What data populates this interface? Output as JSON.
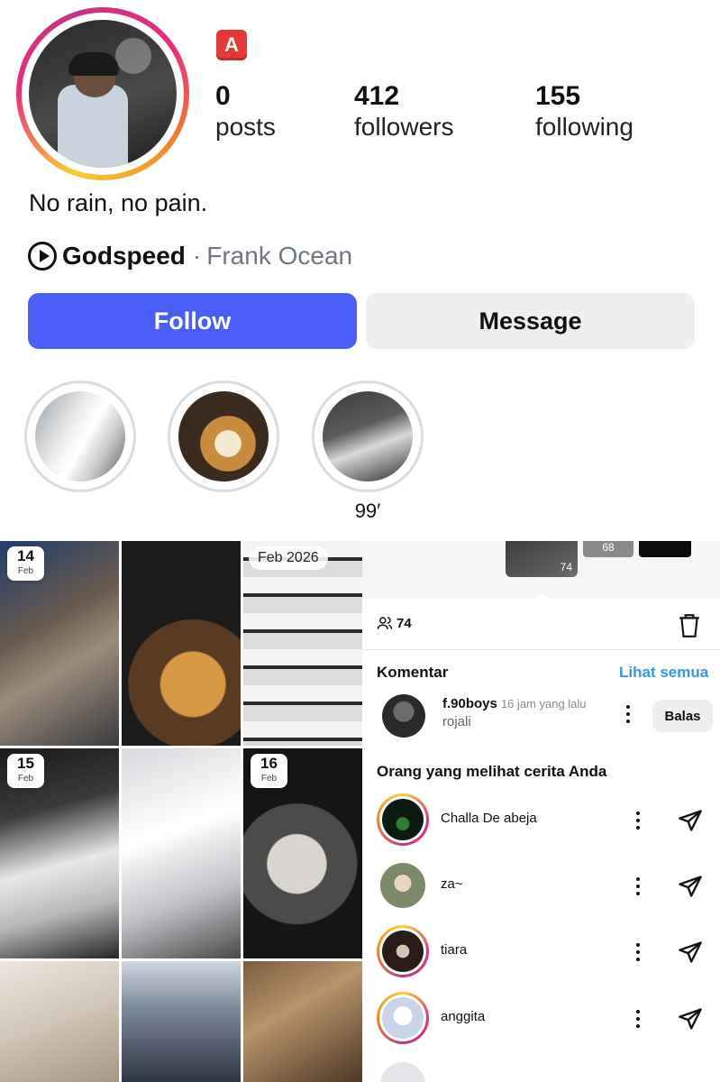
{
  "profile": {
    "badge_letter": "A",
    "stats": [
      {
        "num": "0",
        "label": "posts"
      },
      {
        "num": "412",
        "label": "followers"
      },
      {
        "num": "155",
        "label": "following"
      }
    ],
    "bio": "No rain, no pain.",
    "music": {
      "song": "Godspeed",
      "separator": "·",
      "artist": "Frank Ocean"
    },
    "follow_label": "Follow",
    "message_label": "Message",
    "highlights": [
      {
        "label": ""
      },
      {
        "label": ""
      },
      {
        "label": "99′"
      }
    ]
  },
  "grid": {
    "badges": [
      {
        "day": "14",
        "month": "Feb"
      },
      {
        "month_year": "Feb 2026"
      },
      {
        "day": "15",
        "month": "Feb"
      },
      {
        "day": "16",
        "month": "Feb"
      }
    ]
  },
  "story_panel": {
    "thumb_counts": [
      "74",
      "68"
    ],
    "viewer_count": "74",
    "comments_title": "Komentar",
    "see_all": "Lihat semua",
    "comment": {
      "user": "f.90boys",
      "time": "16 jam yang lalu",
      "text": "rojali",
      "reply_label": "Balas"
    },
    "viewers_title": "Orang yang melihat cerita Anda",
    "viewers": [
      {
        "name": "Challa De abeja",
        "ring": true
      },
      {
        "name": "za~",
        "ring": false
      },
      {
        "name": "tiara",
        "ring": true
      },
      {
        "name": "anggita",
        "ring": true
      }
    ]
  },
  "colors": {
    "follow_blue": "#4a5df9",
    "link_blue": "#2f9af2",
    "badge_red": "#e53935"
  }
}
